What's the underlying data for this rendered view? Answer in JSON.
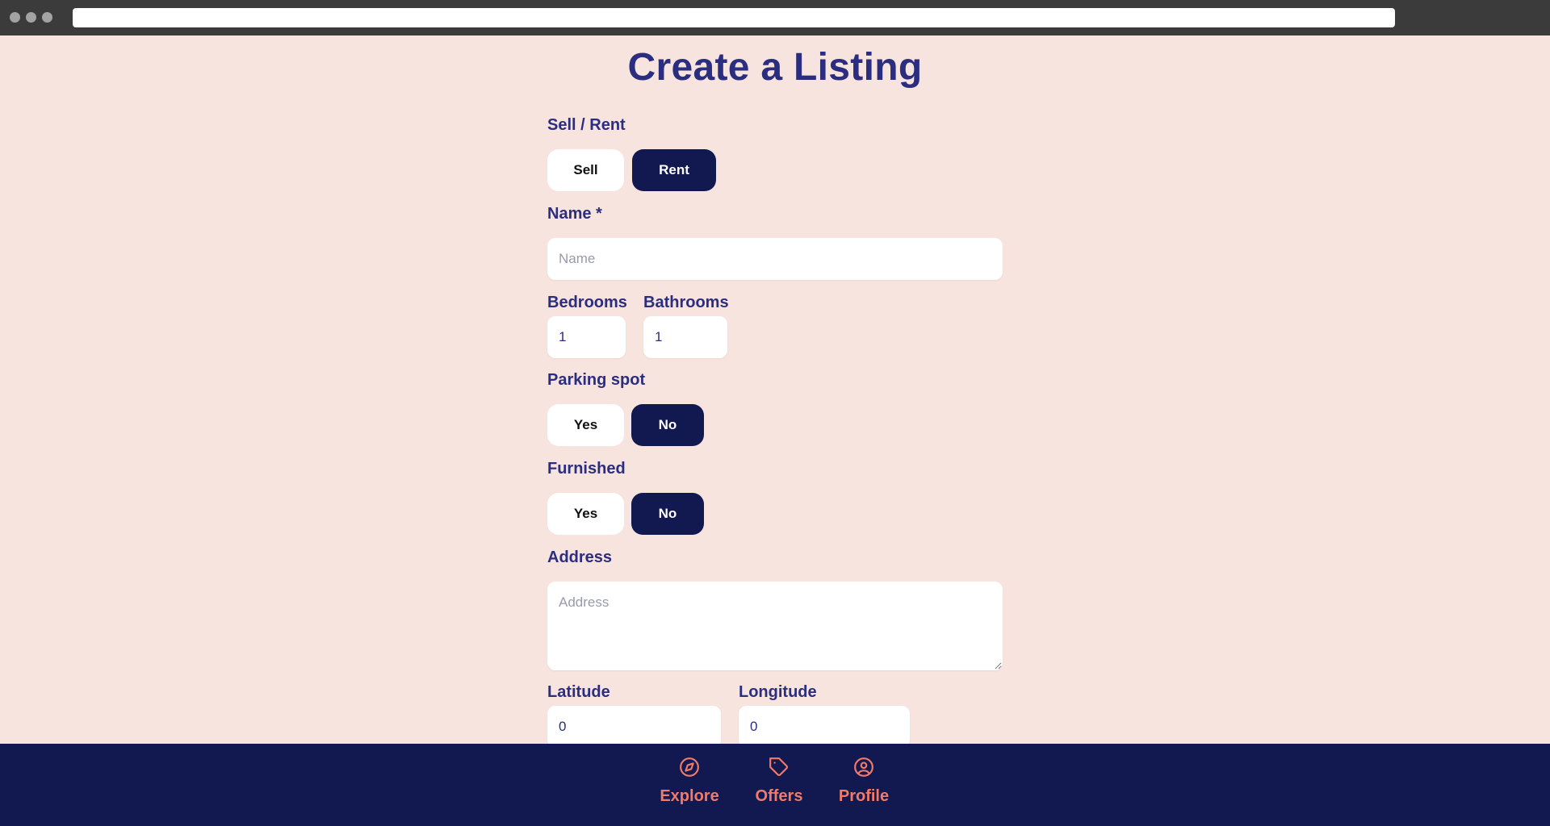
{
  "page": {
    "title": "Create a Listing"
  },
  "form": {
    "type": {
      "label": "Sell / Rent",
      "options": [
        "Sell",
        "Rent"
      ],
      "selected": "Rent"
    },
    "name": {
      "label": "Name *",
      "placeholder": "Name",
      "value": ""
    },
    "bedrooms": {
      "label": "Bedrooms",
      "value": "1"
    },
    "bathrooms": {
      "label": "Bathrooms",
      "value": "1"
    },
    "parking": {
      "label": "Parking spot",
      "options": [
        "Yes",
        "No"
      ],
      "selected": "No"
    },
    "furnished": {
      "label": "Furnished",
      "options": [
        "Yes",
        "No"
      ],
      "selected": "No"
    },
    "address": {
      "label": "Address",
      "placeholder": "Address",
      "value": ""
    },
    "latitude": {
      "label": "Latitude",
      "value": "0"
    },
    "longitude": {
      "label": "Longitude",
      "value": "0"
    }
  },
  "nav": {
    "items": [
      {
        "label": "Explore",
        "icon": "compass-icon"
      },
      {
        "label": "Offers",
        "icon": "tag-icon"
      },
      {
        "label": "Profile",
        "icon": "user-circle-icon"
      }
    ]
  },
  "colors": {
    "background": "#f8e4df",
    "primary": "#121850",
    "text": "#2b2d7e",
    "accent": "#f07b69"
  }
}
